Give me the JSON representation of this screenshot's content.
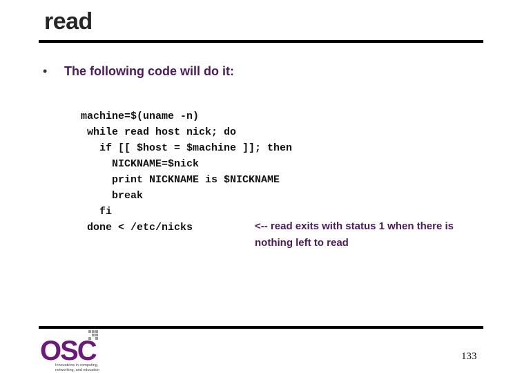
{
  "slide": {
    "title": "read",
    "bullet_symbol": "•",
    "bullet_text": "The following code will do it:",
    "code": "machine=$(uname -n)\n while read host nick; do\n   if [[ $host = $machine ]]; then\n     NICKNAME=$nick\n     print NICKNAME is $NICKNAME\n     break\n   fi\n done < /etc/nicks",
    "annotation": "<--   read exits with status 1 when there is nothing left to read",
    "page_number": "133"
  },
  "logo": {
    "name": "OSC",
    "tagline": "Innovations in computing, networking, and education",
    "color": "#6b1a7a"
  },
  "colors": {
    "accent_text": "#4a1a5c",
    "rule": "#000000"
  }
}
